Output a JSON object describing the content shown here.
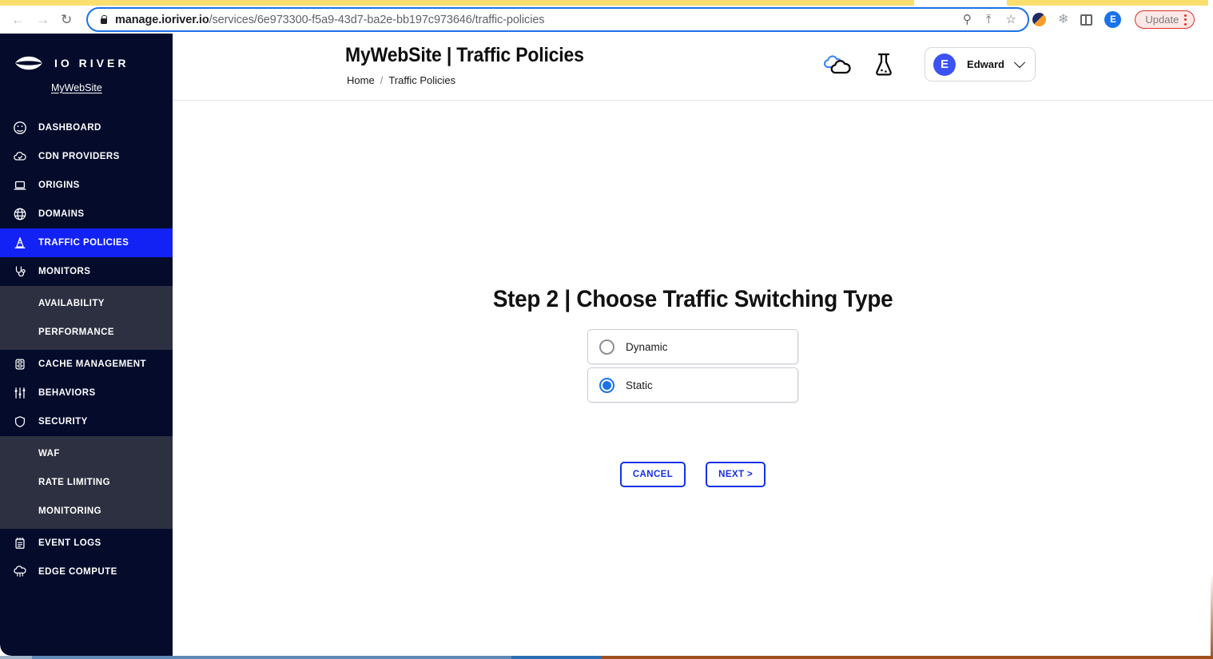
{
  "browser": {
    "back_icon": "back-arrow-icon",
    "forward_icon": "forward-arrow-icon",
    "reload_icon": "reload-icon",
    "url_domain": "manage.ioriver.io",
    "url_path": "/services/6e973300-f5a9-43d7-ba2e-bb197c973646/traffic-policies",
    "url_full": "manage.ioriver.io/services/6e973300-f5a9-43d7-ba2e-bb197c973646/traffic-policies",
    "zoom_icon": "search-zoom-icon",
    "share_icon": "share-icon",
    "bookmark_icon": "star-bookmark-icon",
    "extension_icon": "extension-brand-icon",
    "puzzle_icon": "puzzle-extensions-icon",
    "sidepanel_icon": "side-panel-icon",
    "profile_initial": "E",
    "update_label": "Update",
    "menu_icon": "kebab-menu-icon"
  },
  "sidebar": {
    "brand_name": "IO RIVER",
    "brand_logo": "ioriver-eye-logo",
    "service_link": "MyWebSite",
    "items": [
      {
        "label": "DASHBOARD",
        "icon": "dashboard-gauge-icon",
        "active": false
      },
      {
        "label": "CDN PROVIDERS",
        "icon": "cloud-check-icon",
        "active": false
      },
      {
        "label": "ORIGINS",
        "icon": "laptop-icon",
        "active": false
      },
      {
        "label": "DOMAINS",
        "icon": "globe-icon",
        "active": false
      },
      {
        "label": "TRAFFIC POLICIES",
        "icon": "traffic-cone-icon",
        "active": true
      },
      {
        "label": "MONITORS",
        "icon": "stethoscope-icon",
        "active": false
      },
      {
        "label": "CACHE MANAGEMENT",
        "icon": "database-icon",
        "active": false
      },
      {
        "label": "BEHAVIORS",
        "icon": "sliders-icon",
        "active": false
      },
      {
        "label": "SECURITY",
        "icon": "shield-icon",
        "active": false
      },
      {
        "label": "EVENT LOGS",
        "icon": "notepad-icon",
        "active": false
      },
      {
        "label": "EDGE COMPUTE",
        "icon": "edge-compute-icon",
        "active": false
      }
    ],
    "monitors_sub": [
      {
        "label": "AVAILABILITY"
      },
      {
        "label": "PERFORMANCE"
      }
    ],
    "security_sub": [
      {
        "label": "WAF"
      },
      {
        "label": "RATE LIMITING"
      },
      {
        "label": "MONITORING"
      }
    ],
    "colors": {
      "background": "#050b2b",
      "active": "#1222f5",
      "submenu": "#2d3040"
    }
  },
  "header": {
    "title": "MyWebSite | Traffic Policies",
    "breadcrumb": {
      "home": "Home",
      "separator": "/",
      "current": "Traffic Policies"
    },
    "clouds_icon": "clouds-icon",
    "flask_icon": "lab-flask-icon",
    "user": {
      "initial": "E",
      "name": "Edward",
      "chevron": "chevron-down-icon"
    }
  },
  "main": {
    "step_title": "Step 2 | Choose Traffic Switching Type",
    "options": [
      {
        "label": "Dynamic",
        "selected": false
      },
      {
        "label": "Static",
        "selected": true
      }
    ],
    "cancel_label": "CANCEL",
    "next_label": "NEXT >",
    "accent_color": "#1430e8"
  }
}
